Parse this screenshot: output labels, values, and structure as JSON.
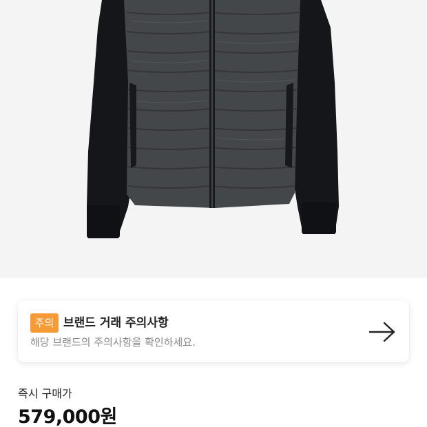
{
  "product": {
    "image_description_icon": "jacket-image"
  },
  "notice": {
    "badge": "주의",
    "title": "브랜드 거래 주의사항",
    "description": "해당 브랜드의 주의사항을 확인하세요.",
    "arrow_icon": "arrow-right-icon",
    "badge_color": "#f59a35"
  },
  "price": {
    "label": "즉시 구매가",
    "value": "579,000원"
  }
}
